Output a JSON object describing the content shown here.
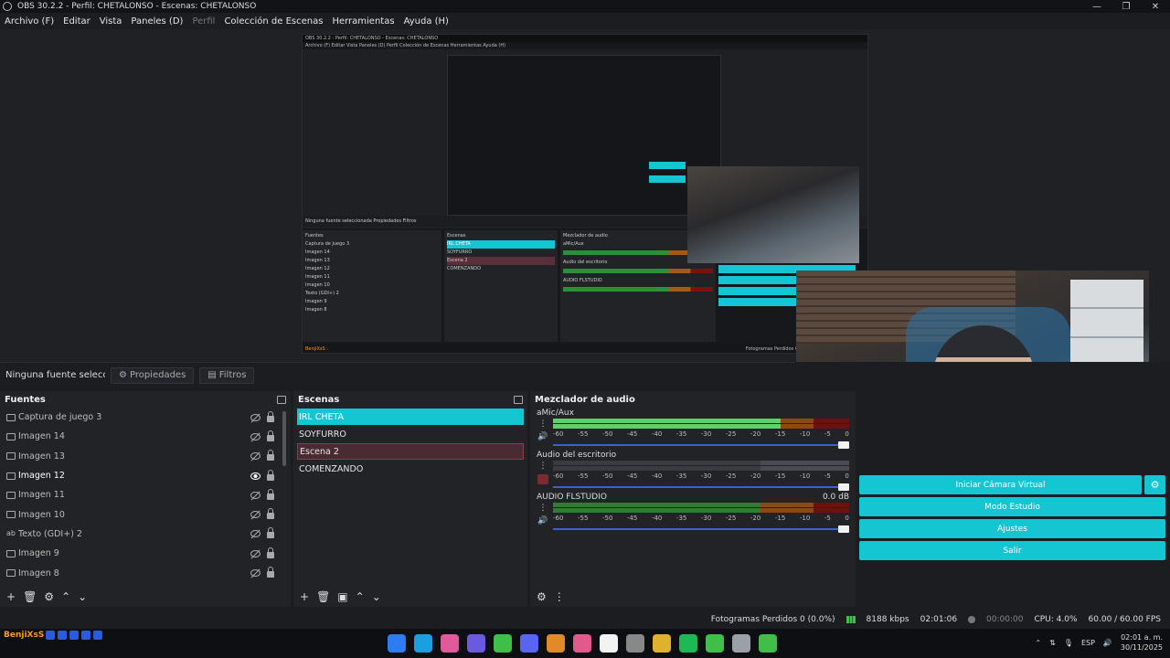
{
  "window": {
    "title": "OBS 30.2.2 - Perfil: CHETALONSO - Escenas: CHETALONSO",
    "minimize": "—",
    "maximize": "❐",
    "close": "✕"
  },
  "menu": [
    "Archivo (F)",
    "Editar",
    "Vista",
    "Paneles (D)",
    "Perfil",
    "Colección de Escenas",
    "Herramientas",
    "Ayuda (H)"
  ],
  "nested_preview": {
    "title": "OBS 30.2.2 - Perfil: CHETALONSO - Escenas: CHETALONSO",
    "menu": "Archivo (F)   Editar   Vista   Paneles (D)   Perfil   Colección de Escenas   Herramientas   Ayuda (H)",
    "props": "Ninguna fuente seleccionada     Propiedades     Filtros",
    "sources_title": "Fuentes",
    "sources": [
      "Captura de Juego 3",
      "Imagen 14",
      "Imagen 13",
      "Imagen 12",
      "Imagen 11",
      "Imagen 10",
      "Texto (GDI+) 2",
      "Imagen 9",
      "Imagen 8"
    ],
    "scenes_title": "Escenas",
    "scenes": [
      "IRL CHETA",
      "SOYFURRO",
      "Escena 2",
      "COMENZANDO"
    ],
    "mixer_title": "Mezclador de audio",
    "tracks": [
      "aMic/Aux",
      "Audio del escritorio",
      "AUDIO FLSTUDIO"
    ],
    "status": "Fotogramas Perdidos 0 (0.0%)   8188 kbps   02:01:06",
    "user": "BenjiXsS :"
  },
  "source_toolbar": {
    "no_source": "Ninguna fuente seleccionada",
    "properties": "Propiedades",
    "filters": "Filtros"
  },
  "sources": {
    "title": "Fuentes",
    "items": [
      {
        "label": "Captura de juego 3",
        "icon": "gamepad-icon",
        "visible": false
      },
      {
        "label": "Imagen 14",
        "icon": "image-icon",
        "visible": false
      },
      {
        "label": "Imagen 13",
        "icon": "image-icon",
        "visible": false
      },
      {
        "label": "Imagen 12",
        "icon": "image-icon",
        "visible": true
      },
      {
        "label": "Imagen 11",
        "icon": "image-icon",
        "visible": false
      },
      {
        "label": "Imagen 10",
        "icon": "image-icon",
        "visible": false
      },
      {
        "label": "Texto (GDI+) 2",
        "icon": "text-icon",
        "visible": false
      },
      {
        "label": "Imagen 9",
        "icon": "image-icon",
        "visible": false
      },
      {
        "label": "Imagen 8",
        "icon": "image-icon",
        "visible": false
      }
    ],
    "text_icon_glyph": "ab",
    "footer": [
      "+",
      "🗑",
      "⚙",
      "⌃",
      "⌄"
    ]
  },
  "scenes": {
    "title": "Escenas",
    "items": [
      {
        "label": "IRL CHETA",
        "state": "selected"
      },
      {
        "label": "SOYFURRO",
        "state": "normal"
      },
      {
        "label": "Escena 2",
        "state": "red"
      },
      {
        "label": "COMENZANDO",
        "state": "normal"
      }
    ],
    "footer": [
      "+",
      "🗑",
      "▣",
      "⌃",
      "⌄"
    ]
  },
  "mixer": {
    "title": "Mezclador de audio",
    "ticks": [
      "-60",
      "-55",
      "-50",
      "-45",
      "-40",
      "-35",
      "-30",
      "-25",
      "-20",
      "-15",
      "-10",
      "-5",
      "0"
    ],
    "tracks": [
      {
        "name": "aMic/Aux",
        "db": "",
        "muted": false,
        "level": 0.77
      },
      {
        "name": "Audio del escritorio",
        "db": "",
        "muted": true,
        "level": 0
      },
      {
        "name": "AUDIO FLSTUDIO",
        "db": "0.0 dB",
        "muted": false,
        "level": 0
      }
    ],
    "menu_glyph": "⋮",
    "volume_glyph": "🔊",
    "footer": [
      "⚙",
      "⋮"
    ]
  },
  "controls": {
    "virtual_cam": "Iniciar Cámara Virtual",
    "studio_mode": "Modo Estudio",
    "settings": "Ajustes",
    "exit": "Salir",
    "gear": "⚙"
  },
  "status": {
    "dropped": "Fotogramas Perdidos 0 (0.0%)",
    "bitrate": "8188 kbps",
    "stream_time": "02:01:06",
    "rec_time": "00:00:00",
    "cpu": "CPU: 4.0%",
    "fps": "60.00 / 60.00 FPS"
  },
  "taskbar": {
    "user": "BenjiXsS :",
    "lang": "ESP",
    "time": "02:01 a. m.",
    "date": "30/11/2025",
    "apps": [
      "#2d7cf0",
      "#1aa0e0",
      "#e05a9a",
      "#6a5ae0",
      "#3fbf4a",
      "#5865f2",
      "#e08a2a",
      "#e05a8a",
      "#f2f2f2",
      "#888888",
      "#e0b12a",
      "#1db954",
      "#3fbf4a",
      "#9aa0a6",
      "#3fbf4a"
    ],
    "accent": "#13c6d1"
  }
}
